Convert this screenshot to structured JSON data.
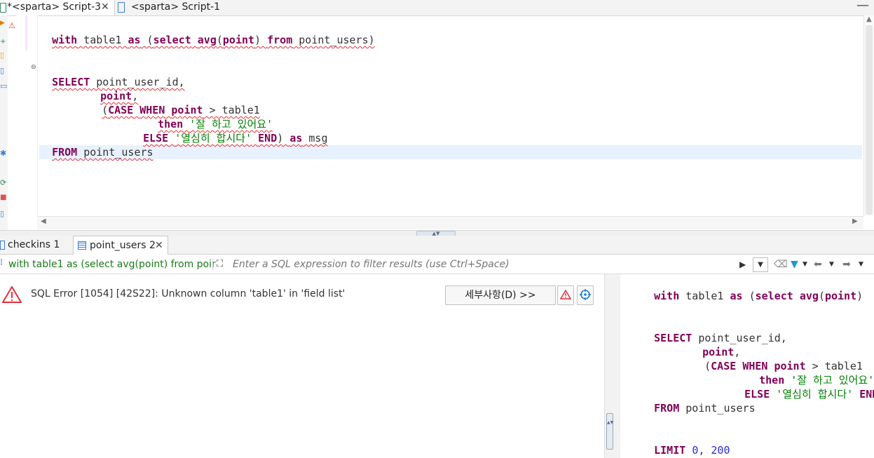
{
  "editor_tabs": [
    {
      "label": "*<sparta> Script-3",
      "active": true
    },
    {
      "label": "<sparta> Script-1",
      "active": false
    }
  ],
  "editor": {
    "l1": {
      "t1": "with",
      "t2": " table1 ",
      "t3": "as",
      "t4": " (",
      "t5": "select",
      "t6": " ",
      "t7": "avg",
      "t8": "(",
      "t9": "point",
      "t10": ") ",
      "t11": "from",
      "t12": " point_users)"
    },
    "l2": {
      "t1": "SELECT",
      "t2": " point_user_id,"
    },
    "l3": {
      "t1": "point",
      "t2": ","
    },
    "l4": {
      "t1": "(",
      "t2": "CASE",
      "t3": " ",
      "t4": "WHEN",
      "t5": " ",
      "t6": "point",
      "t7": " > table1"
    },
    "l5": {
      "t1": "then",
      "t2": " ",
      "t3": "'잘 하고 있어요'"
    },
    "l6": {
      "t1": "ELSE",
      "t2": " ",
      "t3": "'열심히 합시다'",
      "t4": " ",
      "t5": "END",
      "t6": ") ",
      "t7": "as",
      "t8": " msg"
    },
    "l7": {
      "t1": "FROM",
      "t2": " point_users"
    }
  },
  "result_tabs": [
    {
      "label": "checkins 1",
      "active": false
    },
    {
      "label": "point_users 2",
      "active": true
    }
  ],
  "filter": {
    "query": "with table1 as (select avg(point) from poir",
    "placeholder": "Enter a SQL expression to filter results (use Ctrl+Space)"
  },
  "error": {
    "message": "SQL Error [1054] [42S22]: Unknown column 'table1' in 'field list'",
    "details_button": "세부사항(D) >>"
  },
  "sql_panel": {
    "l1": {
      "t1": "with",
      "t2": " table1 ",
      "t3": "as",
      "t4": " (",
      "t5": "select",
      "t6": " ",
      "t7": "avg",
      "t8": "(",
      "t9": "point",
      "t10": ")"
    },
    "l2": {
      "t1": "SELECT",
      "t2": " point_user_id,"
    },
    "l3": {
      "t1": "point",
      "t2": ","
    },
    "l4": {
      "t1": "(",
      "t2": "CASE",
      "t3": " ",
      "t4": "WHEN",
      "t5": " ",
      "t6": "point",
      "t7": " > table1"
    },
    "l5": {
      "t1": "then",
      "t2": " ",
      "t3": "'잘 하고 있어요'"
    },
    "l6": {
      "t1": "ELSE",
      "t2": " ",
      "t3": "'열심히 합시다'",
      "t4": " ",
      "t5": "END"
    },
    "l7": {
      "t1": "FROM",
      "t2": " point_users"
    },
    "l8": {
      "t1": "LIMIT",
      "t2": " ",
      "t3": "0",
      "t4": ", ",
      "t5": "200"
    }
  },
  "colors": {
    "keyword": "#7f0055",
    "string": "#008000",
    "number": "#2a2ad0",
    "error": "#e0303a",
    "filter_text": "#1a7a1a"
  }
}
